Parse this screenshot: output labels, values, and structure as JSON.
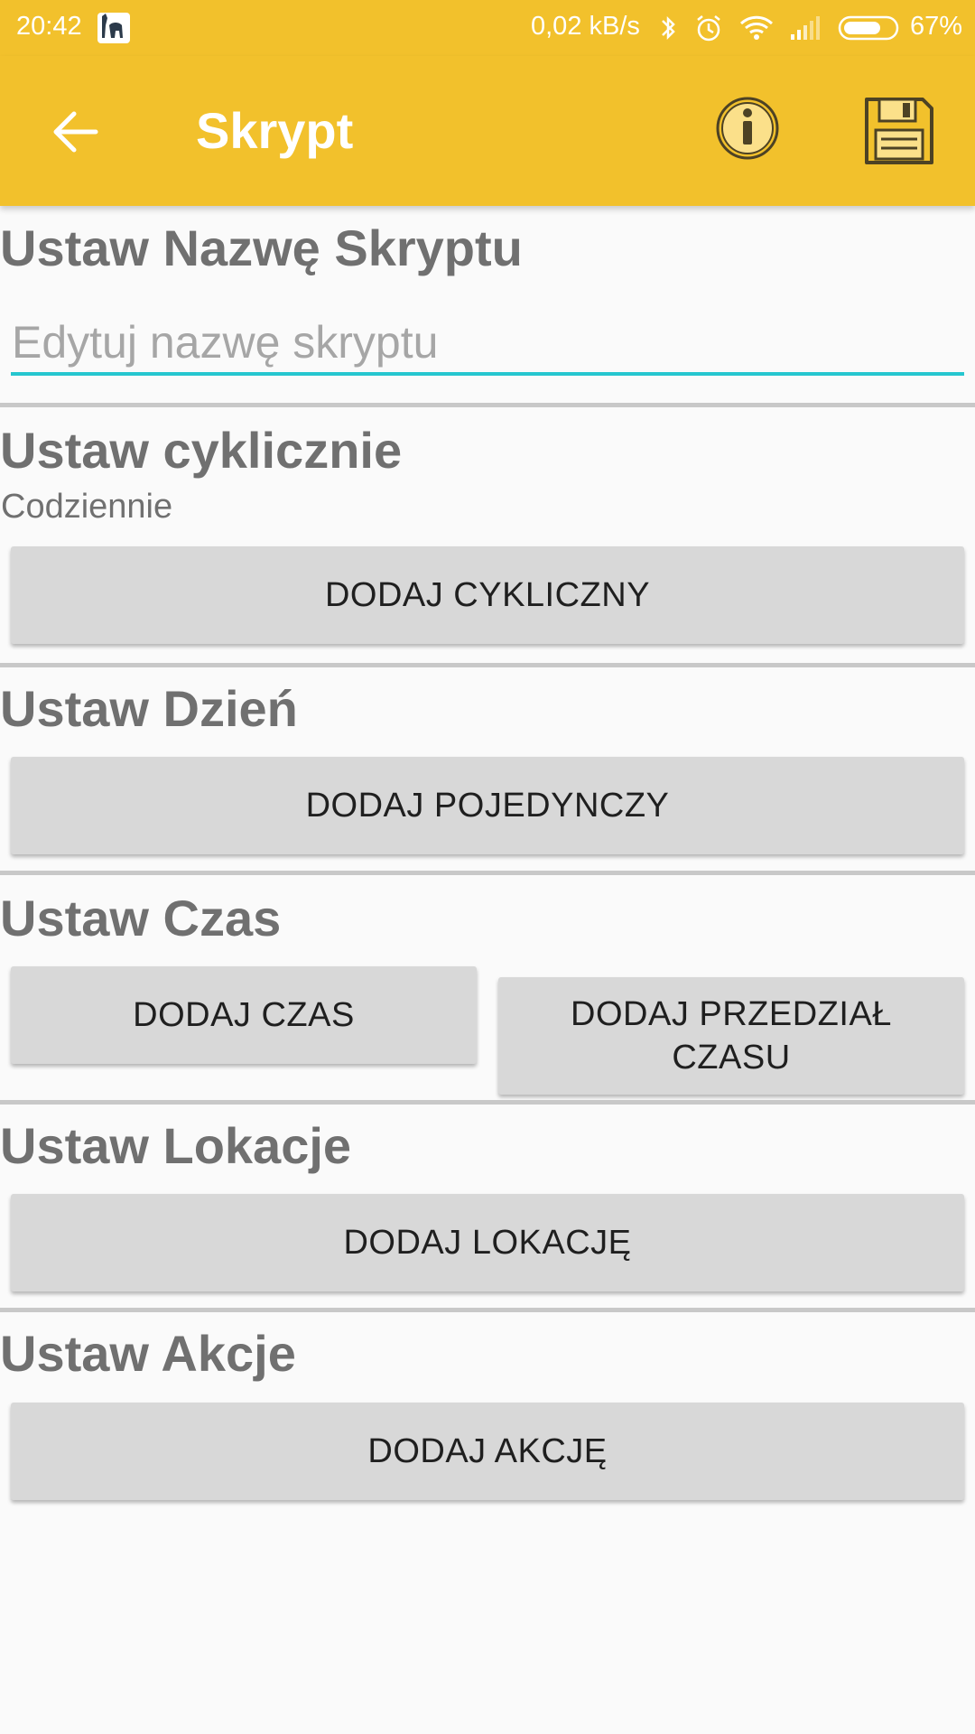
{
  "status_bar": {
    "time": "20:42",
    "net_speed": "0,02 kB/s",
    "battery": "67%",
    "icons": [
      "app-notification-icon",
      "bluetooth-icon",
      "alarm-icon",
      "wifi-icon",
      "signal-icon",
      "battery-icon"
    ]
  },
  "app_bar": {
    "title": "Skrypt",
    "icons": [
      "back-arrow-icon",
      "info-icon",
      "save-icon"
    ]
  },
  "sections": {
    "name": {
      "title": "Ustaw Nazwę Skryptu",
      "placeholder": "Edytuj nazwę skryptu",
      "value": ""
    },
    "cyclic": {
      "title": "Ustaw cyklicznie",
      "subtitle": "Codziennie",
      "button": "DODAJ CYKLICZNY"
    },
    "day": {
      "title": "Ustaw Dzień",
      "button": "DODAJ POJEDYNCZY"
    },
    "time": {
      "title": "Ustaw Czas",
      "button_time": "DODAJ CZAS",
      "button_range": "DODAJ PRZEDZIAŁ CZASU"
    },
    "location": {
      "title": "Ustaw Lokacje",
      "button": "DODAJ LOKACJĘ"
    },
    "action": {
      "title": "Ustaw Akcje",
      "button": "DODAJ AKCJĘ"
    }
  },
  "colors": {
    "accent": "#f2c12c",
    "input_underline": "#26c6cf",
    "button_bg": "#d8d8d8",
    "section_title": "#707070"
  }
}
